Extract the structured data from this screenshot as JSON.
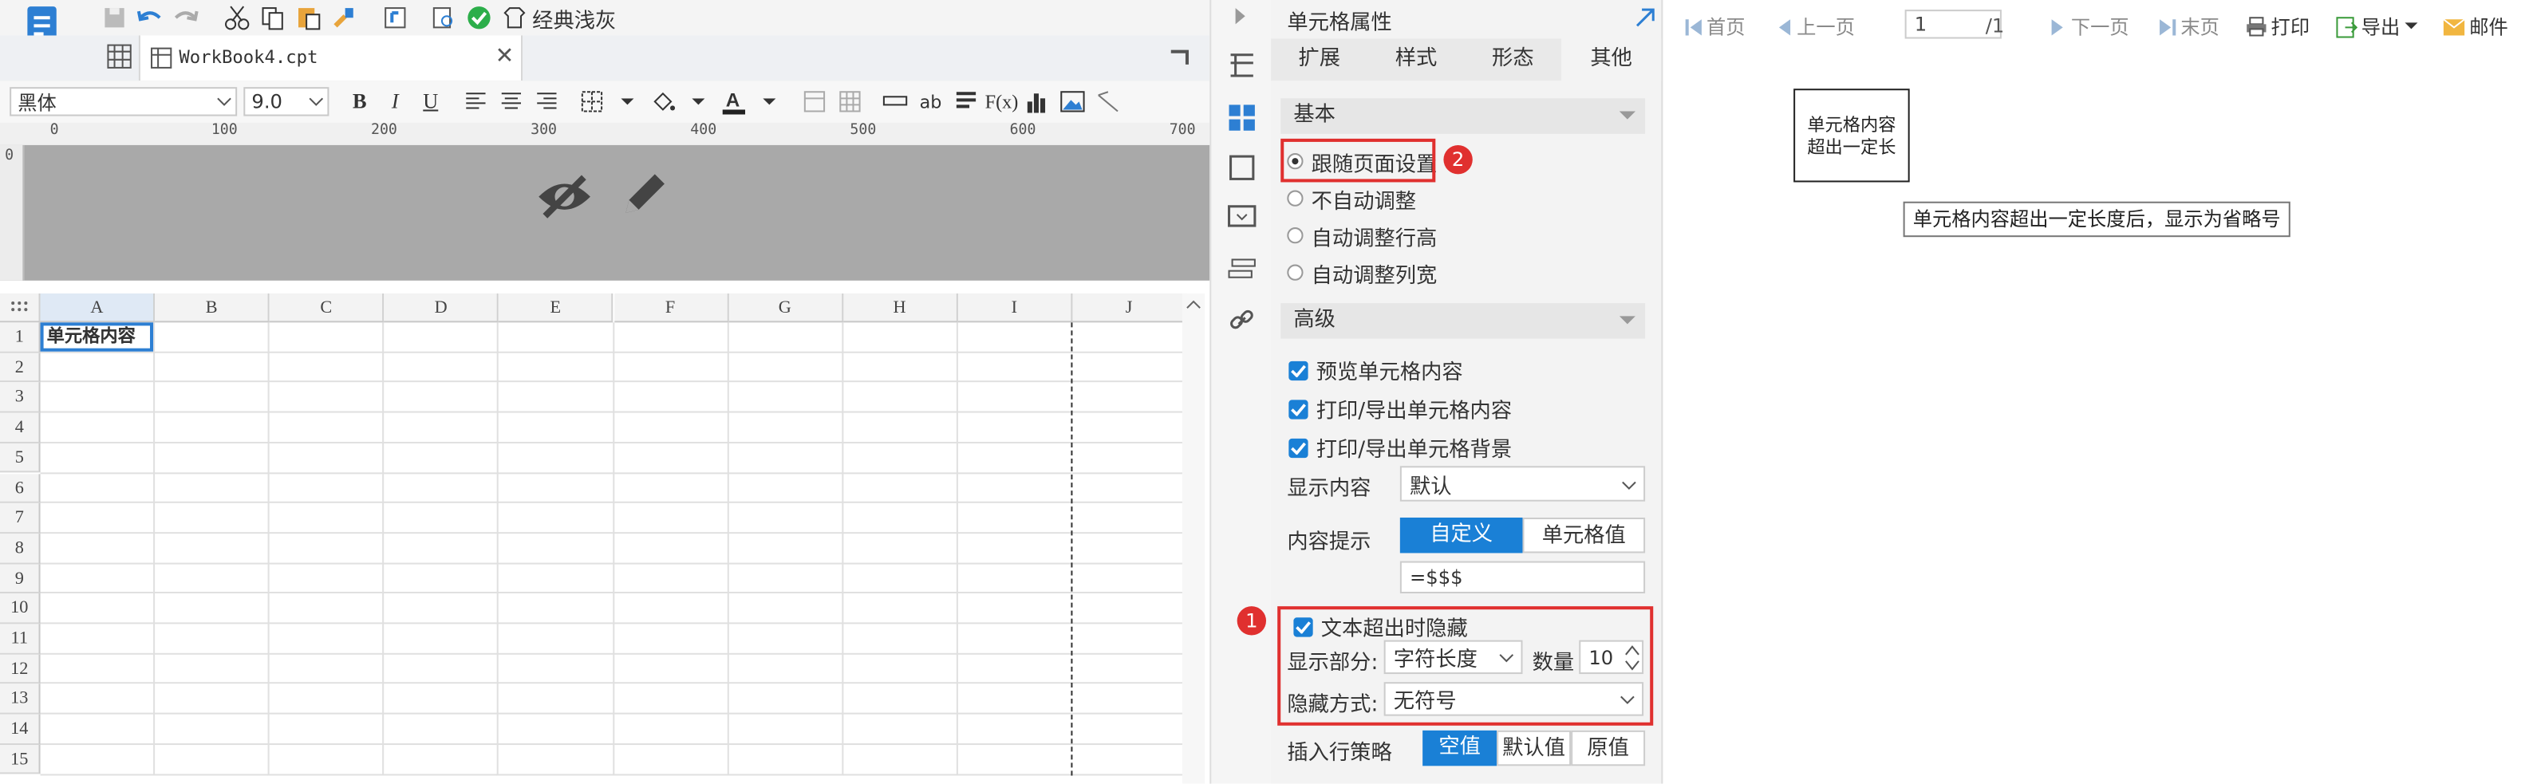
{
  "editor": {
    "toolbar_title": "经典浅灰",
    "tab_name": "WorkBook4.cpt",
    "font_name": "黑体",
    "font_size": "9.0",
    "ruler_ticks": [
      "0",
      "100",
      "200",
      "300",
      "400",
      "500",
      "600",
      "700"
    ],
    "columns": [
      "A",
      "B",
      "C",
      "D",
      "E",
      "F",
      "G",
      "H",
      "I",
      "J"
    ],
    "rows": [
      "1",
      "2",
      "3",
      "4",
      "5",
      "6",
      "7",
      "8",
      "9",
      "10",
      "11",
      "12",
      "13",
      "14",
      "15"
    ],
    "cell_a1": "单元格内容"
  },
  "props": {
    "title": "单元格属性",
    "tabs": [
      "扩展",
      "样式",
      "形态",
      "其他"
    ],
    "active_tab": "其他",
    "basic_section": "基本",
    "radio_options": [
      "跟随页面设置",
      "不自动调整",
      "自动调整行高",
      "自动调整列宽"
    ],
    "advanced_section": "高级",
    "checks": [
      "预览单元格内容",
      "打印/导出单元格内容",
      "打印/导出单元格背景"
    ],
    "display_content_label": "显示内容",
    "display_content_value": "默认",
    "tooltip_label": "内容提示",
    "tooltip_opt_custom": "自定义",
    "tooltip_opt_value": "单元格值",
    "tooltip_formula": "=$$$",
    "hide_overflow_label": "文本超出时隐藏",
    "show_part_label": "显示部分:",
    "show_part_value": "字符长度",
    "count_label": "数量",
    "count_value": "10",
    "hide_mode_label": "隐藏方式:",
    "hide_mode_value": "无符号",
    "insert_policy_label": "插入行策略",
    "insert_opts": [
      "空值",
      "默认值",
      "原值"
    ],
    "badge1": "1",
    "badge2": "2",
    "colors": {
      "accent": "#1a80d6",
      "red": "#e0302f"
    }
  },
  "preview": {
    "first": "首页",
    "prev": "上一页",
    "page_value": "1",
    "total": "/1",
    "next": "下一页",
    "last": "末页",
    "print": "打印",
    "export": "导出",
    "mail": "邮件",
    "cell_text_l1": "单元格内容",
    "cell_text_l2": "超出一定长",
    "tooltip": "单元格内容超出一定长度后，显示为省略号"
  }
}
